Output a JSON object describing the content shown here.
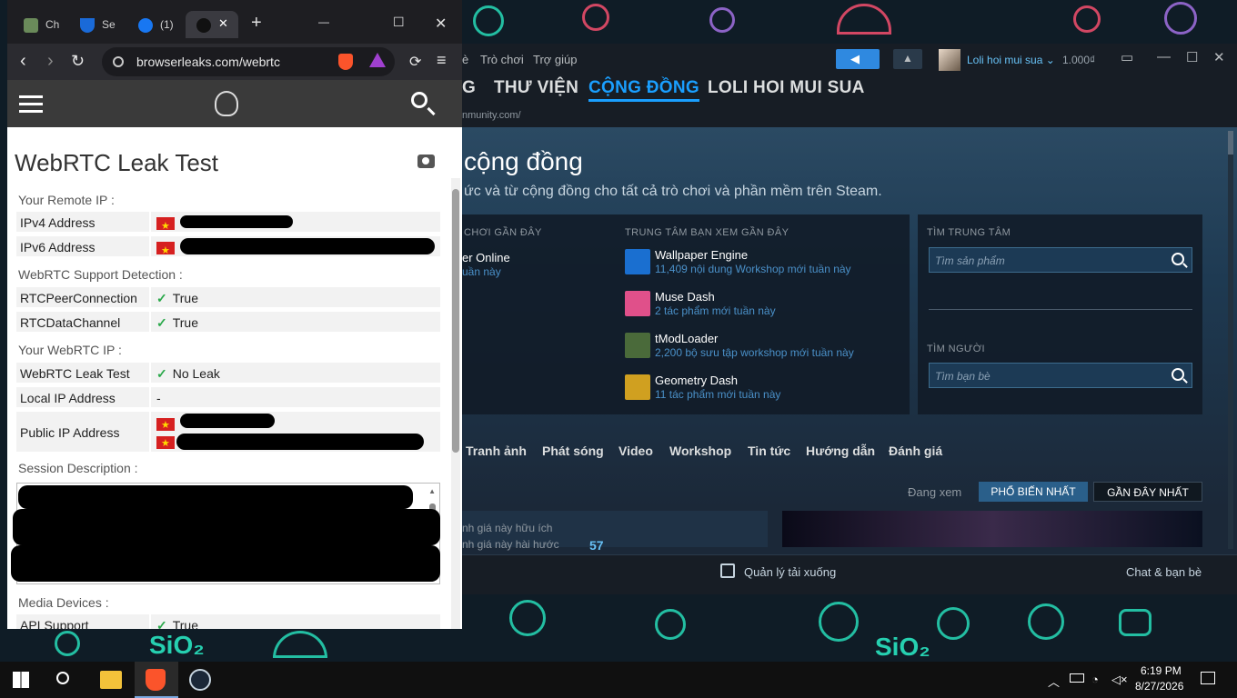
{
  "desktop": {
    "wallpaper_accent_colors": [
      "#e84c6a",
      "#26d0b0",
      "#9a6cd8"
    ],
    "sio2_label": "SiO₂"
  },
  "browser": {
    "tabs": [
      {
        "label": "Ch",
        "icon": "chatgpt-icon"
      },
      {
        "label": "Se",
        "icon": "shield-icon"
      },
      {
        "label": "(1)",
        "icon": "facebook-icon"
      },
      {
        "label": "",
        "icon": "loading-icon",
        "active": true
      }
    ],
    "new_tab_label": "+",
    "minimize_glyph": "—",
    "maximize_glyph": "☐",
    "close_glyph": "✕",
    "url": "browserleaks.com/webrtc",
    "page": {
      "title": "WebRTC Leak Test",
      "sections": {
        "remote_ip": "Your Remote IP :",
        "support": "WebRTC Support Detection :",
        "webrtc_ip": "Your WebRTC IP :",
        "session": "Session Description :",
        "media": "Media Devices :"
      },
      "rows": {
        "ipv4": "IPv4 Address",
        "ipv6": "IPv6 Address",
        "rtcpeer": "RTCPeerConnection",
        "rtcpeer_val": "True",
        "rtcdata": "RTCDataChannel",
        "rtcdata_val": "True",
        "leaktest": "WebRTC Leak Test",
        "leaktest_val": "No Leak",
        "localip": "Local IP Address",
        "localip_val": "-",
        "publicip": "Public IP Address",
        "apisupport": "API Support",
        "apisupport_val": "True"
      },
      "check_glyph": "✓"
    }
  },
  "steam": {
    "menu": [
      "è",
      "Trò chơi",
      "Trợ giúp"
    ],
    "username": "Loli hoi mui sua ⌄",
    "wallet": "1.000₫",
    "nav": [
      {
        "label": "G",
        "active": false
      },
      {
        "label": "THƯ VIỆN",
        "active": false
      },
      {
        "label": "CỘNG ĐỒNG",
        "active": true
      },
      {
        "label": "LOLI HOI MUI SUA",
        "active": false
      }
    ],
    "url_fragment": "nmunity.com/",
    "hero_title": "cộng đồng",
    "hero_subtitle": "ức và từ cộng đồng cho tất cả trò chơi và phần mềm trên Steam.",
    "recent_games_header": "CHƠI GẦN ĐÂY",
    "recent_game_title": "er Online",
    "recent_game_sub": "uần này",
    "hubs_header": "TRUNG TÂM BẠN XEM GẦN ĐÂY",
    "hubs": [
      {
        "name": "Wallpaper Engine",
        "sub": "11,409 nội dung Workshop mới tuần này",
        "color": "#1a6fd0"
      },
      {
        "name": "Muse Dash",
        "sub": "2 tác phẩm mới tuần này",
        "color": "#e0508a"
      },
      {
        "name": "tModLoader",
        "sub": "2,200 bộ sưu tập workshop mới tuần này",
        "color": "#4a6a3a"
      },
      {
        "name": "Geometry Dash",
        "sub": "11 tác phẩm mới tuần này",
        "color": "#d0a020"
      }
    ],
    "find_hub_header": "TÌM TRUNG TÂM",
    "find_hub_placeholder": "Tìm sản phẩm",
    "find_people_header": "TÌM NGƯỜI",
    "find_people_placeholder": "Tìm bạn bè",
    "tabs": [
      "Tranh ảnh",
      "Phát sóng",
      "Video",
      "Workshop",
      "Tin tức",
      "Hướng dẫn",
      "Đánh giá"
    ],
    "view_label": "Đang xem",
    "popular_label": "PHỔ BIẾN NHẤT",
    "recent_label": "GẦN ĐÂY NHẤT",
    "card_line1": "nh giá này hữu ích",
    "card_line2": "nh giá này hài hước",
    "card_count": "57",
    "downloads_label": "Quản lý tải xuống",
    "chat_label": "Chat & bạn bè"
  },
  "taskbar": {
    "time": "6:19 PM",
    "date": "8/27/2026",
    "apps": [
      "windows-start-icon",
      "search-icon",
      "file-explorer-icon",
      "brave-icon",
      "steam-icon"
    ]
  }
}
